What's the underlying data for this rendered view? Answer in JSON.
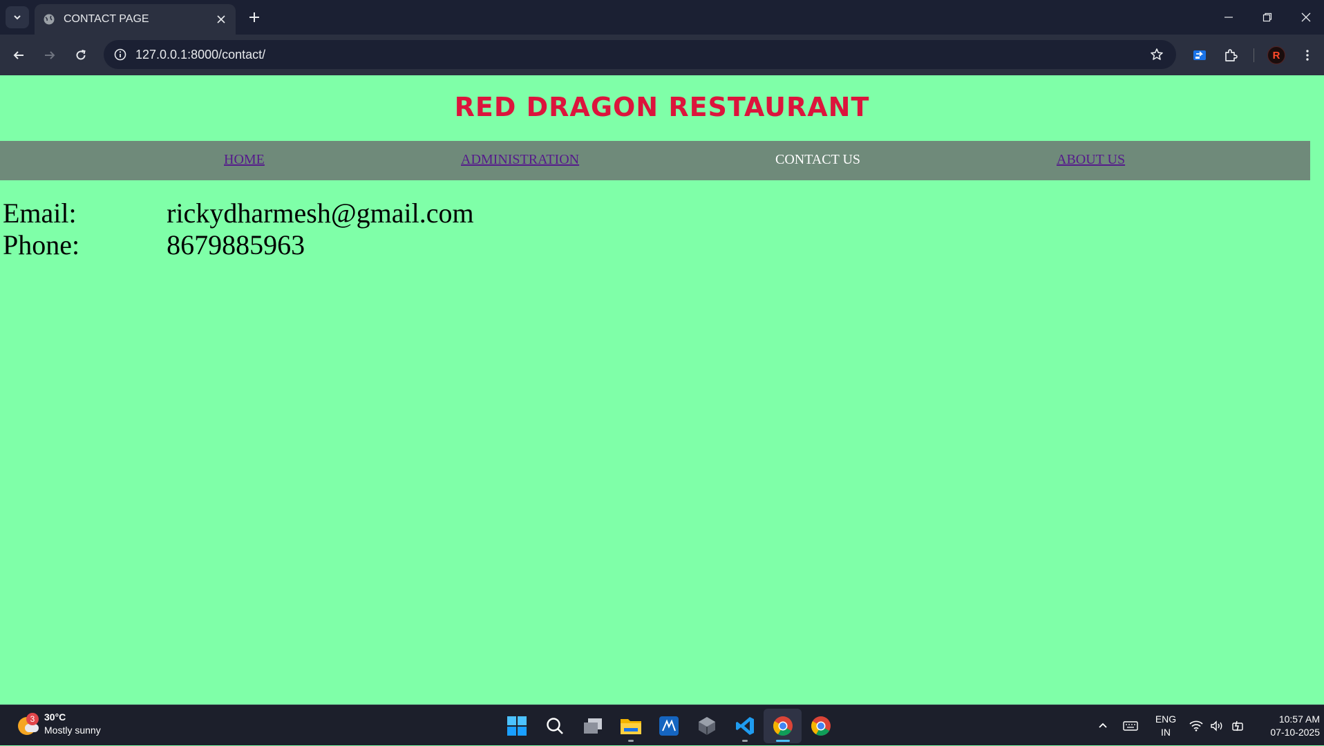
{
  "browser": {
    "tab_title": "CONTACT PAGE",
    "url": "127.0.0.1:8000/contact/",
    "profile_initial": "R"
  },
  "site": {
    "title": "RED DRAGON RESTAURANT",
    "nav": [
      {
        "label": "HOME",
        "current": false
      },
      {
        "label": "ADMINISTRATION",
        "current": false
      },
      {
        "label": "CONTACT US",
        "current": true
      },
      {
        "label": "ABOUT US",
        "current": false
      }
    ],
    "contact": {
      "email_label": "Email:",
      "email_value": "rickydharmesh@gmail.com",
      "phone_label": "Phone:",
      "phone_value": "8679885963"
    }
  },
  "taskbar": {
    "weather_badge": "3",
    "weather_temp": "30°C",
    "weather_desc": "Mostly sunny",
    "lang_top": "ENG",
    "lang_bottom": "IN",
    "time": "10:57 AM",
    "date": "07-10-2025"
  },
  "colors": {
    "page_bg": "#7fffa8",
    "title": "#dc143c",
    "navbar_bg": "#6f8a7a",
    "link": "#551a8b"
  }
}
